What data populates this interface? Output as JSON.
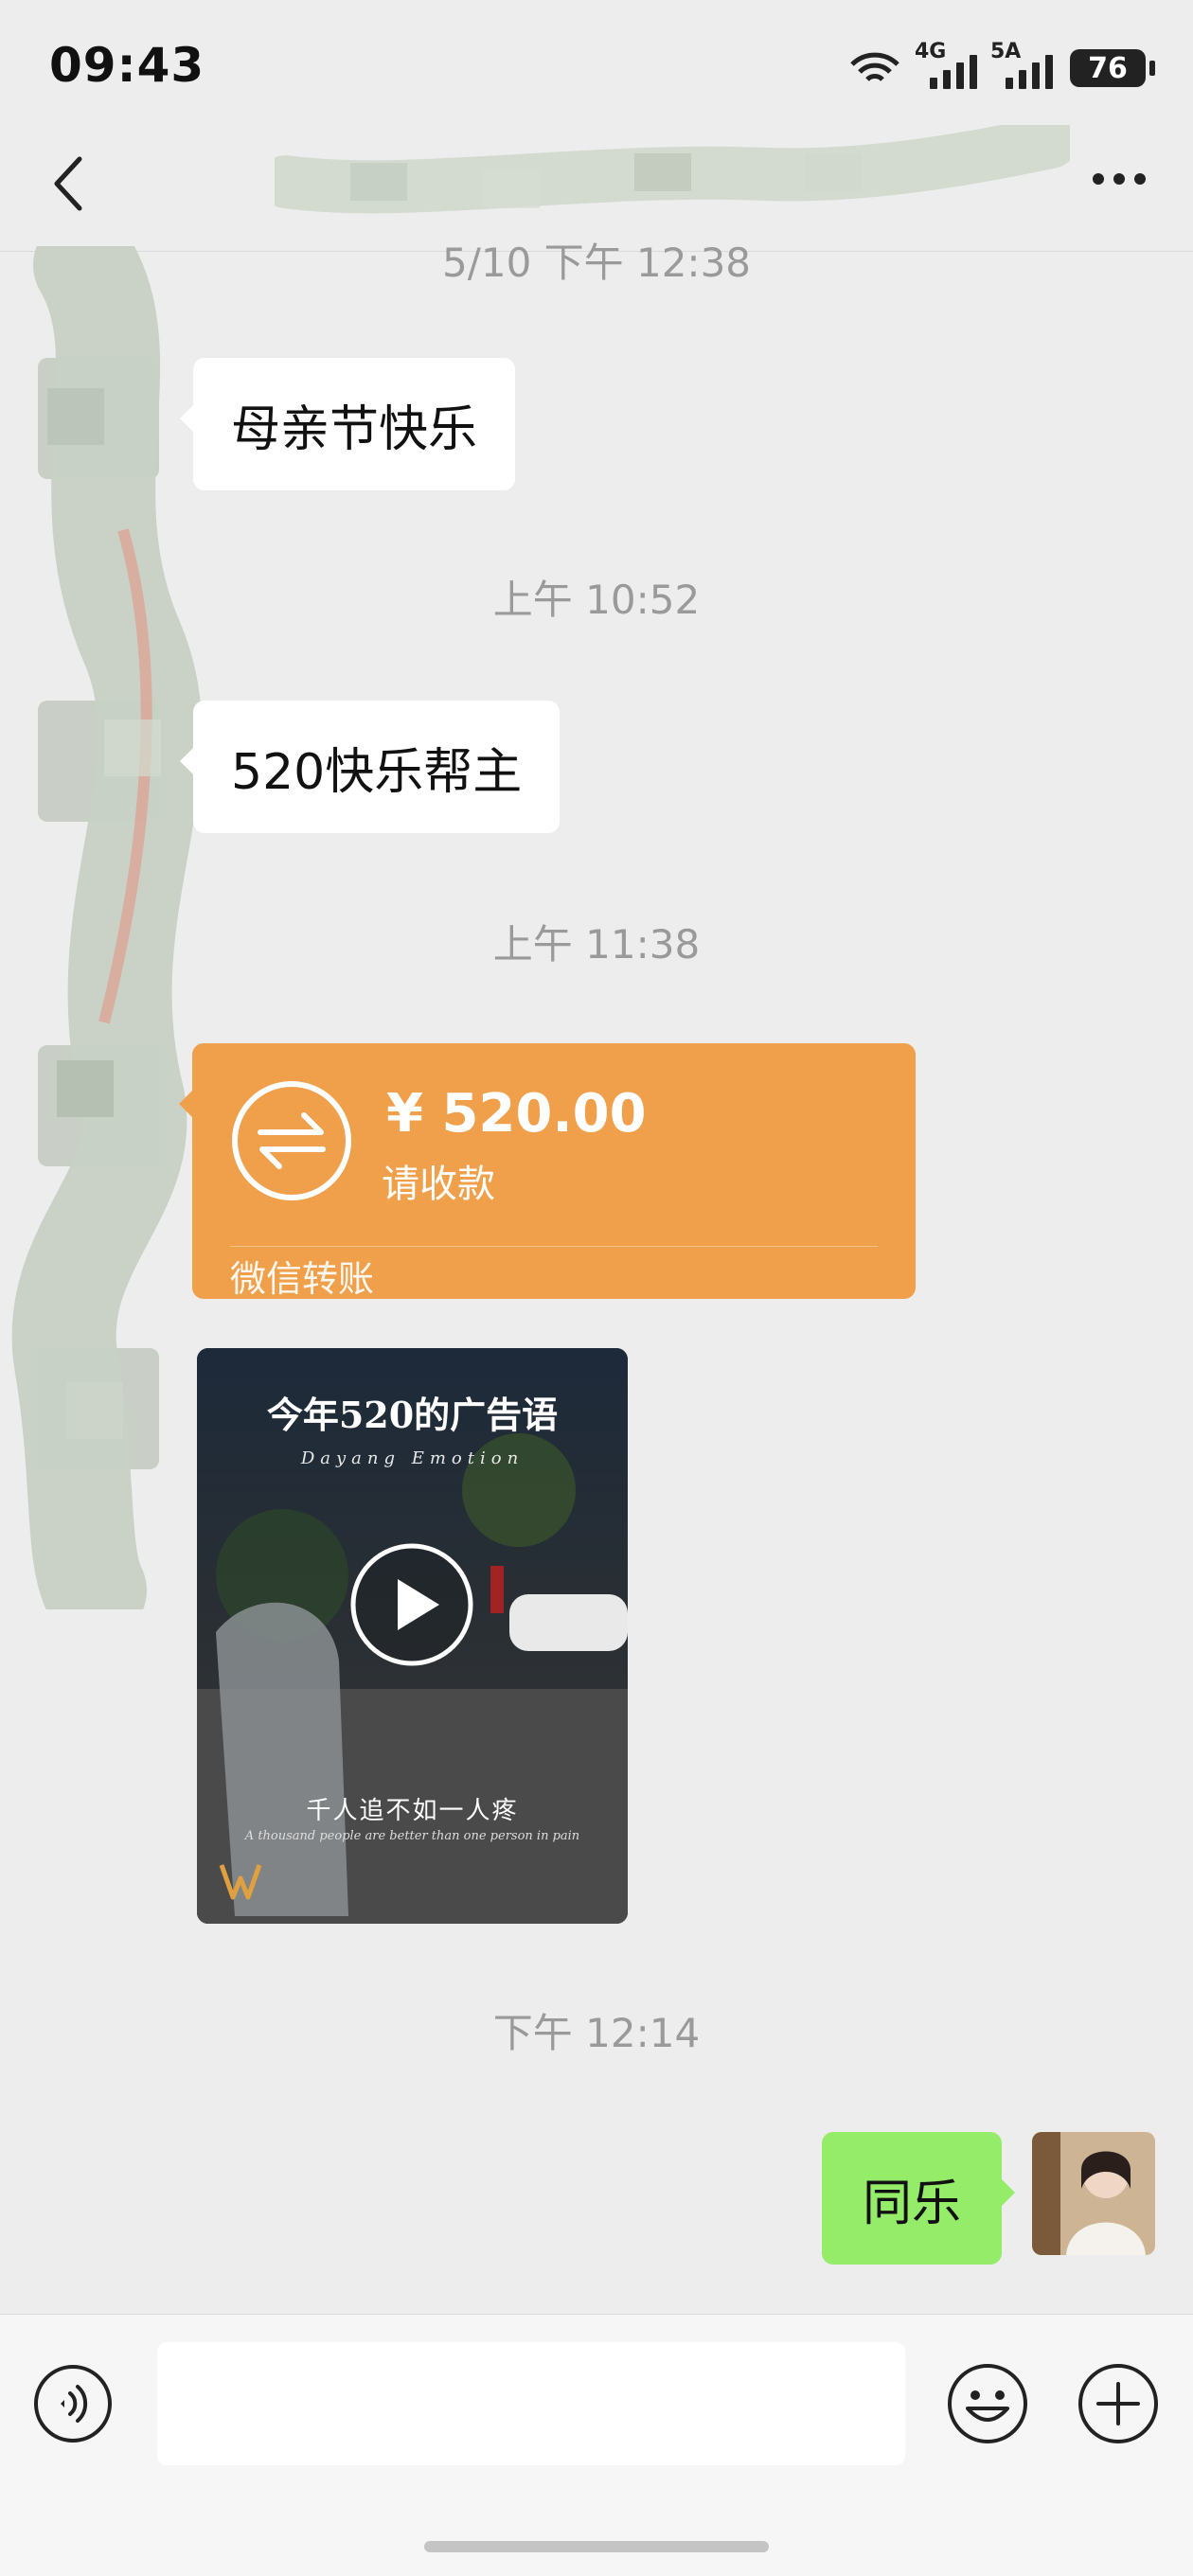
{
  "status_bar": {
    "time": "09:43",
    "signal1_label": "4G",
    "signal2_label": "5A",
    "battery": "76"
  },
  "header": {
    "back_icon": "chevron-left-icon",
    "title": "",
    "more_icon": "ellipsis-icon"
  },
  "messages": [
    {
      "type": "timestamp",
      "text": "5/10 下午 12:38"
    },
    {
      "type": "text",
      "side": "left",
      "text": "母亲节快乐"
    },
    {
      "type": "timestamp",
      "text": "上午 10:52"
    },
    {
      "type": "text",
      "side": "left",
      "text": "520快乐帮主"
    },
    {
      "type": "timestamp",
      "text": "上午 11:38"
    },
    {
      "type": "transfer",
      "side": "left",
      "amount": "¥ 520.00",
      "status": "请收款",
      "label": "微信转账"
    },
    {
      "type": "video",
      "side": "left",
      "title": "今年520的广告语",
      "subtitle": "Dayang Emotion",
      "caption": "千人追不如一人疼",
      "caption_en": "A thousand people are better than one person in pain"
    },
    {
      "type": "timestamp",
      "text": "下午 12:14"
    },
    {
      "type": "text",
      "side": "right",
      "text": "同乐"
    }
  ],
  "input_bar": {
    "voice_icon": "voice-icon",
    "placeholder": "",
    "emoji_icon": "emoji-icon",
    "plus_icon": "plus-icon"
  },
  "colors": {
    "background": "#ededed",
    "transfer": "#f0a04b",
    "my_bubble": "#95ec69",
    "other_bubble": "#ffffff"
  }
}
